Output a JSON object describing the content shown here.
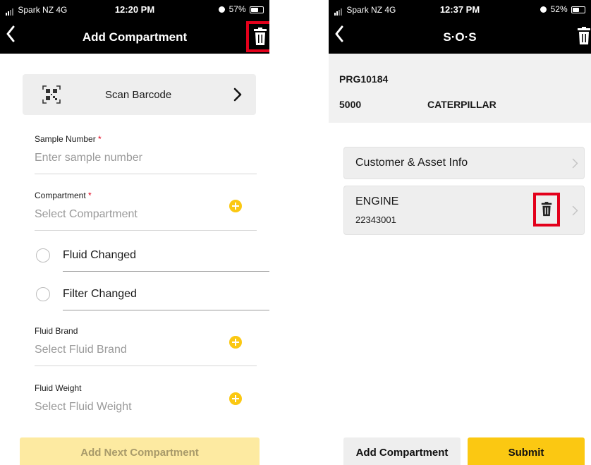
{
  "left": {
    "status": {
      "carrier": "Spark NZ 4G",
      "time": "12:20 PM",
      "battery": "57%"
    },
    "nav": {
      "title": "Add Compartment"
    },
    "scan": {
      "label": "Scan Barcode"
    },
    "sample": {
      "label": "Sample Number",
      "required": "*",
      "placeholder": "Enter sample number"
    },
    "compartment": {
      "label": "Compartment",
      "required": "*",
      "placeholder": "Select Compartment"
    },
    "fluid_changed": {
      "label": "Fluid Changed"
    },
    "filter_changed": {
      "label": "Filter Changed"
    },
    "fluid_brand": {
      "label": "Fluid Brand",
      "placeholder": "Select Fluid Brand"
    },
    "fluid_weight": {
      "label": "Fluid Weight",
      "placeholder": "Select Fluid Weight"
    },
    "add_next": "Add Next Compartment"
  },
  "right": {
    "status": {
      "carrier": "Spark NZ 4G",
      "time": "12:37 PM",
      "battery": "52%"
    },
    "nav": {
      "title": "S·O·S"
    },
    "info": {
      "po": "PRG10184",
      "number": "5000",
      "make": "CATERPILLAR"
    },
    "customer_asset": "Customer & Asset Info",
    "compartment_item": {
      "title": "ENGINE",
      "serial": "22343001"
    },
    "add_compartment": "Add Compartment",
    "submit": "Submit"
  },
  "colors": {
    "accent": "#fbc812",
    "highlight": "#e3001b",
    "navbar": "#000000"
  }
}
